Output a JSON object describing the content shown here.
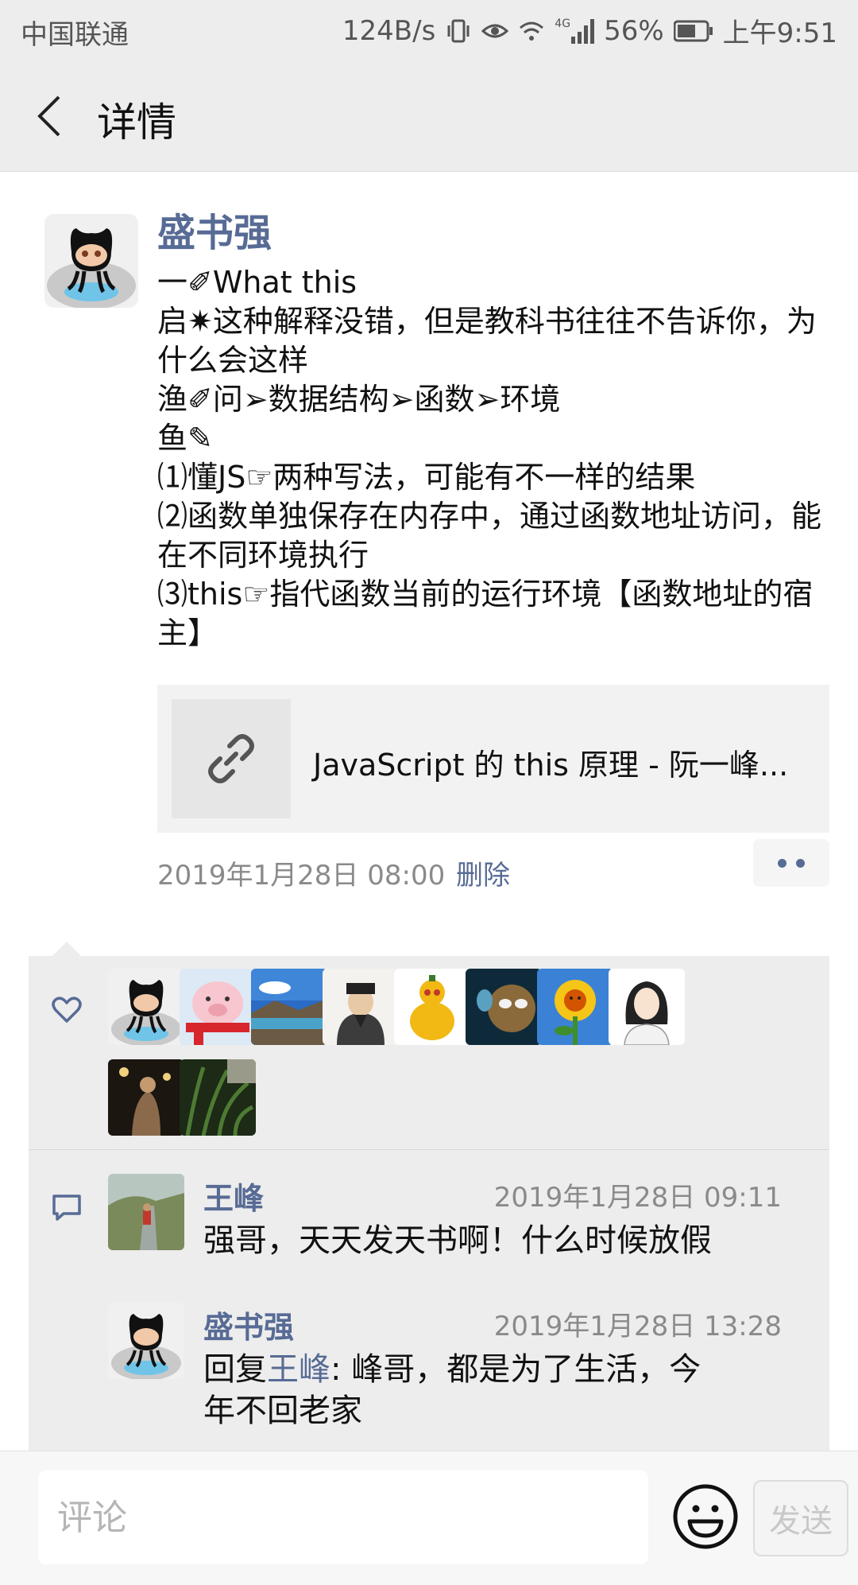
{
  "status_bar": {
    "carrier": "中国联通",
    "speed": "124B/s",
    "network": "4G",
    "battery": "56%",
    "time": "上午9:51"
  },
  "header": {
    "title": "详情"
  },
  "post": {
    "author": "盛书强",
    "lines": [
      "一✐What this",
      "启✷这种解释没错，但是教科书往往不告诉你，为什么会这样",
      "渔✐问➢数据结构➢函数➢环境",
      "鱼✎",
      "⑴懂JS☞两种写法，可能有不一样的结果",
      "⑵函数单独保存在内存中，通过函数地址访问，能在不同环境执行",
      "⑶this☞指代函数当前的运行环境【函数地址的宿主】"
    ],
    "link_title": "JavaScript 的 this 原理 - 阮一峰...",
    "time": "2019年1月28日 08:00",
    "delete_label": "删除"
  },
  "comments": [
    {
      "name": "王峰",
      "time": "2019年1月28日 09:11",
      "text": "强哥，天天发天书啊！什么时候放假"
    },
    {
      "name": "盛书强",
      "time": "2019年1月28日 13:28",
      "reply_prefix": "回复",
      "reply_to": "王峰",
      "text": ": 峰哥，都是为了生活，今年不回老家"
    }
  ],
  "input": {
    "placeholder": "评论",
    "send_label": "发送"
  }
}
